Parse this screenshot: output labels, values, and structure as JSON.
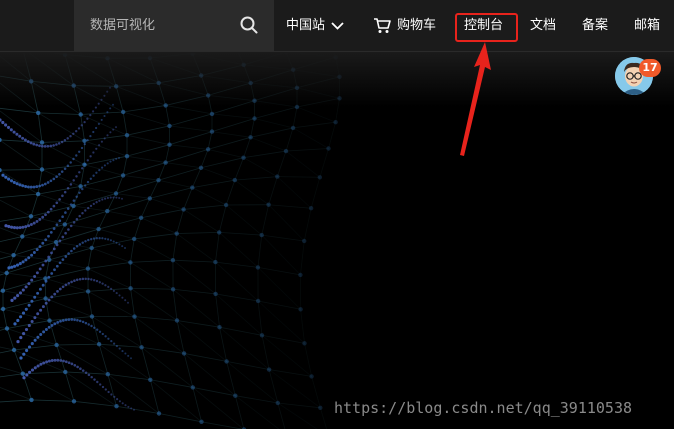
{
  "search": {
    "placeholder": "数据可视化"
  },
  "nav": {
    "region_label": "中国站",
    "cart_label": "购物车",
    "console_label": "控制台",
    "docs_label": "文档",
    "beian_label": "备案",
    "mail_label": "邮箱"
  },
  "user": {
    "notification_count": "17"
  },
  "watermark": "https://blog.csdn.net/qq_39110538",
  "colors": {
    "highlight": "#e8231c",
    "badge": "#f05a2a",
    "bar": "#1b1b1b"
  }
}
